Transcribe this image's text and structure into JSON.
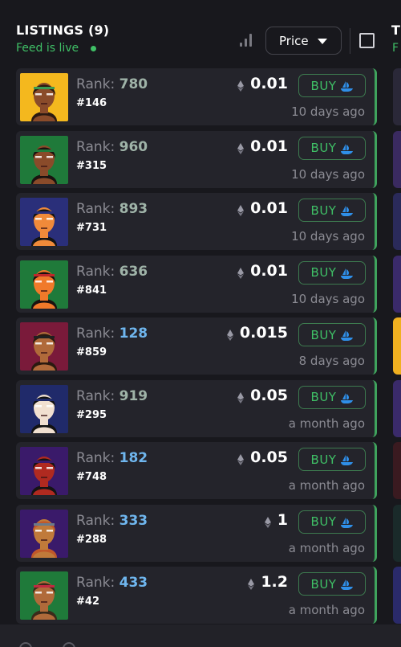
{
  "header": {
    "title": "LISTINGS (9)",
    "feed_status": "Feed is live",
    "sort_label": "Price",
    "next_column_title": "T",
    "next_column_feed": "F",
    "colors": {
      "live": "#3fbf66",
      "accent_border": "#3fa35d"
    }
  },
  "listings": [
    {
      "rank_label": "Rank:",
      "rank": "780",
      "id": "#146",
      "price": "0.01",
      "buy_label": "BUY",
      "time": "10 days ago",
      "avatar_bg": "#f4b81e",
      "skin": "#8a4b2a",
      "hair": "#2b1a12",
      "accent": "#3a9a52",
      "rank_color": "gray"
    },
    {
      "rank_label": "Rank:",
      "rank": "960",
      "id": "#315",
      "price": "0.01",
      "buy_label": "BUY",
      "time": "10 days ago",
      "avatar_bg": "#1f7a3a",
      "skin": "#8a4b2a",
      "hair": "#1a1210",
      "accent": "#1f7a3a",
      "rank_color": "gray"
    },
    {
      "rank_label": "Rank:",
      "rank": "893",
      "id": "#731",
      "price": "0.01",
      "buy_label": "BUY",
      "time": "10 days ago",
      "avatar_bg": "#2a2f7a",
      "skin": "#f08a3a",
      "hair": "#141414",
      "accent": "#2a2f7a",
      "rank_color": "gray"
    },
    {
      "rank_label": "Rank:",
      "rank": "636",
      "id": "#841",
      "price": "0.01",
      "buy_label": "BUY",
      "time": "10 days ago",
      "avatar_bg": "#1f7a3a",
      "skin": "#f07a2a",
      "hair": "#1a1210",
      "accent": "#c0282a",
      "rank_color": "gray"
    },
    {
      "rank_label": "Rank:",
      "rank": "128",
      "id": "#859",
      "price": "0.015",
      "buy_label": "BUY",
      "time": "8 days ago",
      "avatar_bg": "#7a1a3a",
      "skin": "#b06a3a",
      "hair": "#2a1a10",
      "accent": "#202020",
      "rank_color": "blue"
    },
    {
      "rank_label": "Rank:",
      "rank": "919",
      "id": "#295",
      "price": "0.05",
      "buy_label": "BUY",
      "time": "a month ago",
      "avatar_bg": "#202a6a",
      "skin": "#f1e0d0",
      "hair": "#121212",
      "accent": "#202a6a",
      "rank_color": "gray"
    },
    {
      "rank_label": "Rank:",
      "rank": "182",
      "id": "#748",
      "price": "0.05",
      "buy_label": "BUY",
      "time": "a month ago",
      "avatar_bg": "#3a1a6a",
      "skin": "#b02a20",
      "hair": "#141414",
      "accent": "#3a1a6a",
      "rank_color": "blue"
    },
    {
      "rank_label": "Rank:",
      "rank": "333",
      "id": "#288",
      "price": "1",
      "buy_label": "BUY",
      "time": "a month ago",
      "avatar_bg": "#3a1a6a",
      "skin": "#c07a3a",
      "hair": "#c0582a",
      "accent": "#6a7a8a",
      "rank_color": "blue"
    },
    {
      "rank_label": "Rank:",
      "rank": "433",
      "id": "#42",
      "price": "1.2",
      "buy_label": "BUY",
      "time": "a month ago",
      "avatar_bg": "#1f7a3a",
      "skin": "#b06a3a",
      "hair": "#3a2a1a",
      "accent": "#c02a40",
      "rank_color": "blue"
    }
  ],
  "right_column_colors": [
    "#2a2838",
    "#3a2a60",
    "#2a2a5a",
    "#3a2a6a",
    "#f0b020",
    "#3a2a6a",
    "#3a1a20",
    "#1a2a2a",
    "#2a2a6a"
  ]
}
